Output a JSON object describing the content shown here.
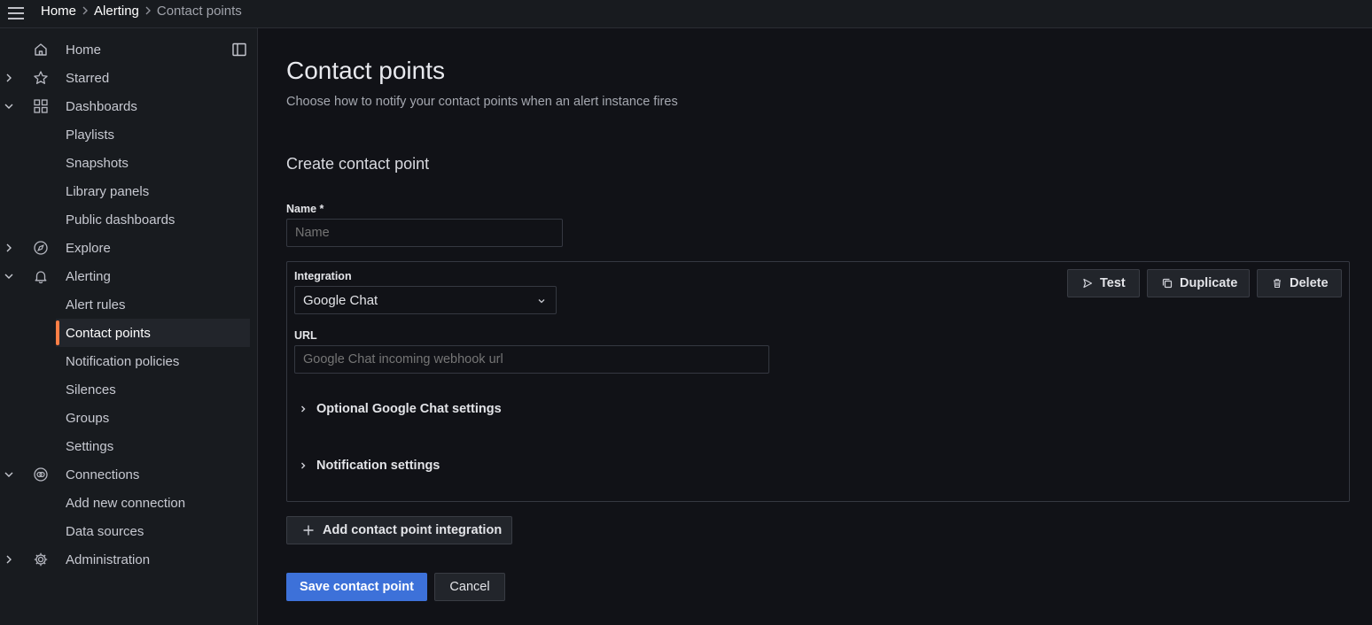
{
  "breadcrumb": [
    "Home",
    "Alerting",
    "Contact points"
  ],
  "sidebar": {
    "items": [
      {
        "label": "Home",
        "icon": "home-icon",
        "chevron": ""
      },
      {
        "label": "Starred",
        "icon": "star-icon",
        "chevron": "right"
      },
      {
        "label": "Dashboards",
        "icon": "apps-icon",
        "chevron": "down"
      },
      {
        "label": "Playlists",
        "icon": "",
        "chevron": ""
      },
      {
        "label": "Snapshots",
        "icon": "",
        "chevron": ""
      },
      {
        "label": "Library panels",
        "icon": "",
        "chevron": ""
      },
      {
        "label": "Public dashboards",
        "icon": "",
        "chevron": ""
      },
      {
        "label": "Explore",
        "icon": "compass-icon",
        "chevron": "right"
      },
      {
        "label": "Alerting",
        "icon": "bell-icon",
        "chevron": "down"
      },
      {
        "label": "Alert rules",
        "icon": "",
        "chevron": ""
      },
      {
        "label": "Contact points",
        "icon": "",
        "chevron": "",
        "active": true
      },
      {
        "label": "Notification policies",
        "icon": "",
        "chevron": ""
      },
      {
        "label": "Silences",
        "icon": "",
        "chevron": ""
      },
      {
        "label": "Groups",
        "icon": "",
        "chevron": ""
      },
      {
        "label": "Settings",
        "icon": "",
        "chevron": ""
      },
      {
        "label": "Connections",
        "icon": "connections-icon",
        "chevron": "down"
      },
      {
        "label": "Add new connection",
        "icon": "",
        "chevron": ""
      },
      {
        "label": "Data sources",
        "icon": "",
        "chevron": ""
      },
      {
        "label": "Administration",
        "icon": "cog-icon",
        "chevron": "right"
      }
    ]
  },
  "page": {
    "title": "Contact points",
    "subtitle": "Choose how to notify your contact points when an alert instance fires",
    "section_title": "Create contact point"
  },
  "form": {
    "name_label": "Name *",
    "name_placeholder": "Name",
    "integration_label": "Integration",
    "integration_value": "Google Chat",
    "url_label": "URL",
    "url_placeholder": "Google Chat incoming webhook url",
    "optional_settings": "Optional Google Chat settings",
    "notification_settings": "Notification settings",
    "test_label": "Test",
    "duplicate_label": "Duplicate",
    "delete_label": "Delete",
    "add_integration_label": "Add contact point integration",
    "save_label": "Save contact point",
    "cancel_label": "Cancel"
  },
  "colors": {
    "background": "#111217",
    "sidebar": "#181b1f",
    "primary": "#3d71d9",
    "active_indicator": "#ff7f46"
  }
}
